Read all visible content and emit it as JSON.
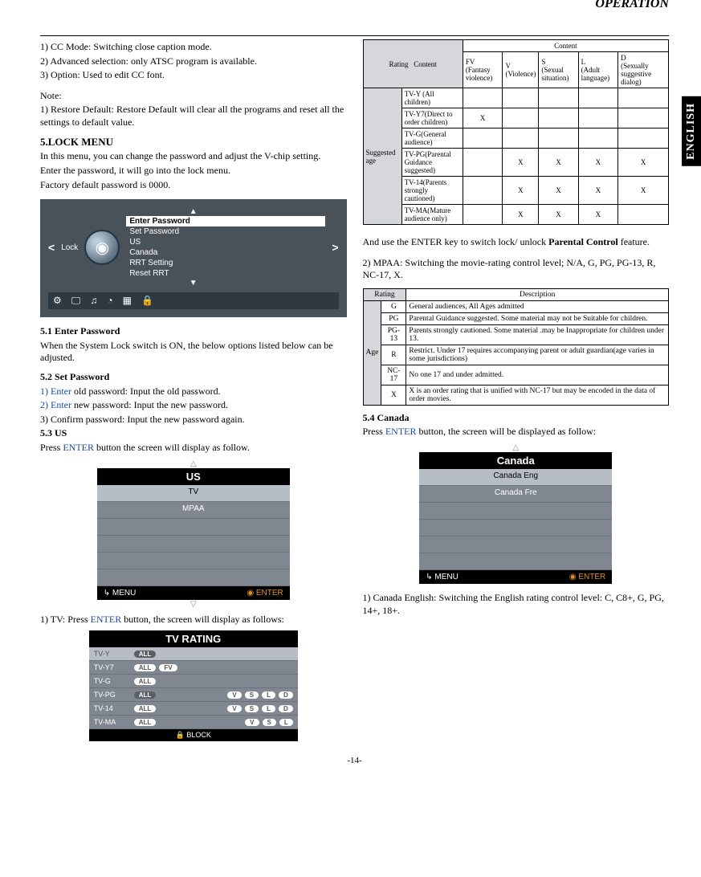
{
  "header": {
    "section": "OPERATION",
    "sideTab": "ENGLISH",
    "pageNum": "-14-"
  },
  "left": {
    "intro": [
      "1) CC Mode: Switching close caption mode.",
      "2) Advanced selection: only ATSC program is available.",
      "3) Option: Used to edit CC font."
    ],
    "noteTitle": "Note:",
    "note": "1) Restore Default: Restore Default will clear all the programs and reset all the settings to default value.",
    "lockMenuTitle": "5.LOCK MENU",
    "lockMenuText": [
      "In this menu, you can change the password and adjust the V-chip setting.",
      "Enter the password, it will go into the lock menu.",
      "Factory default password is 0000."
    ],
    "lockOsd": {
      "label": "Lock",
      "items": [
        "Enter Password",
        "Set Password",
        "US",
        "Canada",
        "RRT Setting",
        "Reset RRT"
      ],
      "selected": 0,
      "icons": [
        "⚙",
        "🖵",
        "♫",
        "◔",
        "▦",
        "🔒"
      ]
    },
    "s51title": "5.1 Enter Password",
    "s51text": "When the System Lock switch is ON, the below options listed below can be adjusted.",
    "s52title": "5.2 Set Password",
    "s52a_pre": "1) Enter",
    "s52a_post": " old password: Input the old password.",
    "s52b_pre": "2) Enter",
    "s52b_post": " new password: Input the new password.",
    "s52c": "3) Confirm password: Input the new password again.",
    "s53title": "5.3 US",
    "s53text_a": "Press ",
    "s53text_b": "ENTER",
    "s53text_c": " button the screen will display as follow.",
    "usMenu": {
      "title": "US",
      "rows": [
        "TV",
        "MPAA",
        "",
        "",
        "",
        ""
      ],
      "footLeft": "MENU",
      "footRight": "ENTER"
    },
    "tvLine_a": "1) TV: Press ",
    "tvLine_b": "ENTER",
    "tvLine_c": " button, the screen will display as follows:",
    "tvr": {
      "title": "TV RATING",
      "rows": [
        {
          "label": "TV-Y",
          "all": "ALL",
          "pills": []
        },
        {
          "label": "TV-Y7",
          "all": "ALL",
          "pills": [
            "FV"
          ]
        },
        {
          "label": "TV-G",
          "all": "ALL",
          "pills": []
        },
        {
          "label": "TV-PG",
          "all": "ALL",
          "pills": [
            "V",
            "S",
            "L",
            "D"
          ]
        },
        {
          "label": "TV-14",
          "all": "ALL",
          "pills": [
            "V",
            "S",
            "L",
            "D"
          ]
        },
        {
          "label": "TV-MA",
          "all": "ALL",
          "pills": [
            "V",
            "S",
            "L"
          ]
        }
      ],
      "foot": "BLOCK"
    }
  },
  "right": {
    "table1": {
      "ratingHdr": "Rating",
      "contentHdr": "Content",
      "cols": [
        {
          "k": "FV",
          "d": "(Fantasy violence)"
        },
        {
          "k": "V",
          "d": "(Violence)"
        },
        {
          "k": "S",
          "d": "(Sexual situation)"
        },
        {
          "k": "L",
          "d": "(Adult language)"
        },
        {
          "k": "D",
          "d": "(Sexually suggestive dialog)"
        }
      ],
      "rowHdr": "Suggested age",
      "rows": [
        {
          "l": "TV-Y (All children)",
          "x": [
            "",
            "",
            "",
            "",
            ""
          ]
        },
        {
          "l": "TV-Y7(Direct to order children)",
          "x": [
            "X",
            "",
            "",
            "",
            ""
          ]
        },
        {
          "l": "TV-G(General audience)",
          "x": [
            "",
            "",
            "",
            "",
            ""
          ]
        },
        {
          "l": "TV-PG(Parental Guidance suggested)",
          "x": [
            "",
            "X",
            "X",
            "X",
            "X"
          ]
        },
        {
          "l": "TV-14(Parents strongly cautioned)",
          "x": [
            "",
            "X",
            "X",
            "X",
            "X"
          ]
        },
        {
          "l": "TV-MA(Mature audience only)",
          "x": [
            "",
            "X",
            "X",
            "X",
            ""
          ]
        }
      ]
    },
    "enterLine_a": "And use the ENTER key to switch lock/ unlock ",
    "enterLine_b": "Parental Control",
    "enterLine_c": " feature.",
    "mpaaLine": "2) MPAA: Switching the movie-rating control level; N/A, G, PG, PG-13, R, NC-17, X.",
    "table2": {
      "ratingHdr": "Rating",
      "descHdr": "Description",
      "ageHdr": "Age",
      "rows": [
        {
          "r": "G",
          "d": "General audiences, All Ages admitted"
        },
        {
          "r": "PG",
          "d": "Parental Guidance suggested. Some material may not be Suitable for children."
        },
        {
          "r": "PG-13",
          "d": "Parents strongly cautioned. Some material .may be Inappropriate for children under 13."
        },
        {
          "r": "R",
          "d": "Restrict. Under 17 requires accompanying parent or adult guardian(age varies in some jurisdictions)"
        },
        {
          "r": "NC-17",
          "d": "No one 17 and under admitted."
        },
        {
          "r": "X",
          "d": "X  is an order rating that is unified with NC-17 but may be encoded in the data of order movies."
        }
      ]
    },
    "s54title": "5.4 Canada",
    "s54a": "Press ",
    "s54b": "ENTER",
    "s54c": " button, the screen will be displayed as follow:",
    "caMenu": {
      "title": "Canada",
      "rows": [
        "Canada Eng",
        "Canada Fre",
        "",
        "",
        "",
        ""
      ],
      "footLeft": "MENU",
      "footRight": "ENTER"
    },
    "caLine": "1) Canada English: Switching the English rating control level: C, C8+, G, PG, 14+, 18+."
  }
}
